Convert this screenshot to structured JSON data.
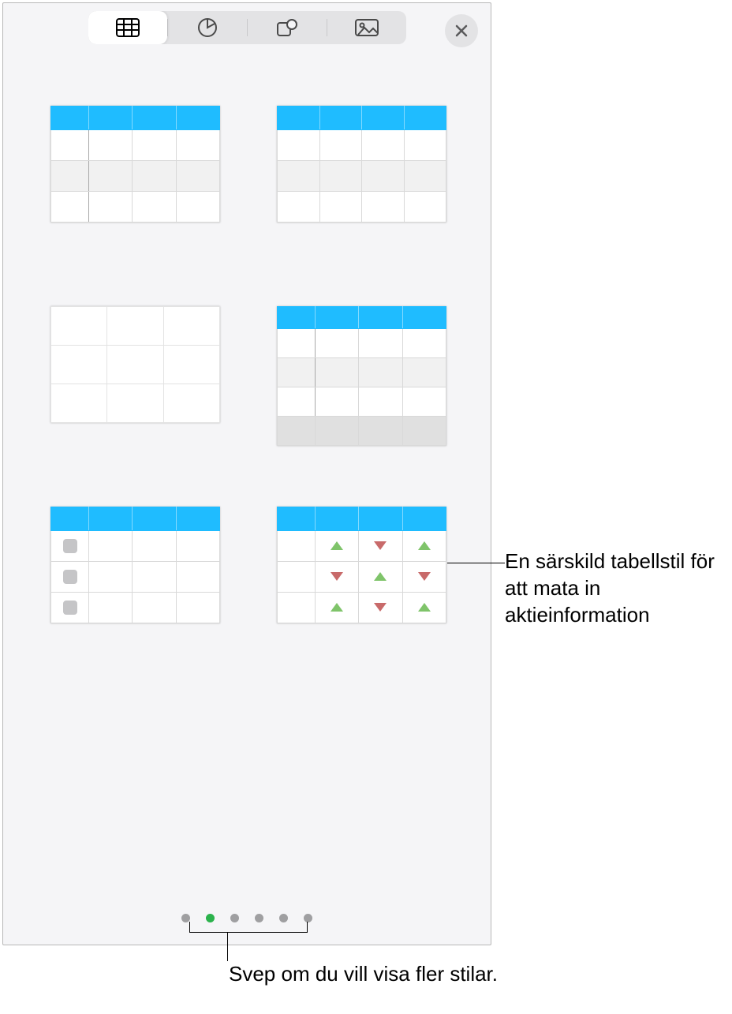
{
  "toolbar": {
    "tabs": [
      "table",
      "chart",
      "shape",
      "media"
    ],
    "active_index": 0
  },
  "styles": [
    {
      "id": "blue-header-alt-rows"
    },
    {
      "id": "blue-header-plain"
    },
    {
      "id": "no-header-plain"
    },
    {
      "id": "blue-header-footer"
    },
    {
      "id": "blue-header-checklist"
    },
    {
      "id": "blue-header-stocks"
    }
  ],
  "pagination": {
    "count": 6,
    "active": 1
  },
  "callouts": {
    "stock_style": "En särskild tabellstil för att mata in aktieinformation",
    "swipe_hint": "Svep om du vill visa fler stilar."
  }
}
